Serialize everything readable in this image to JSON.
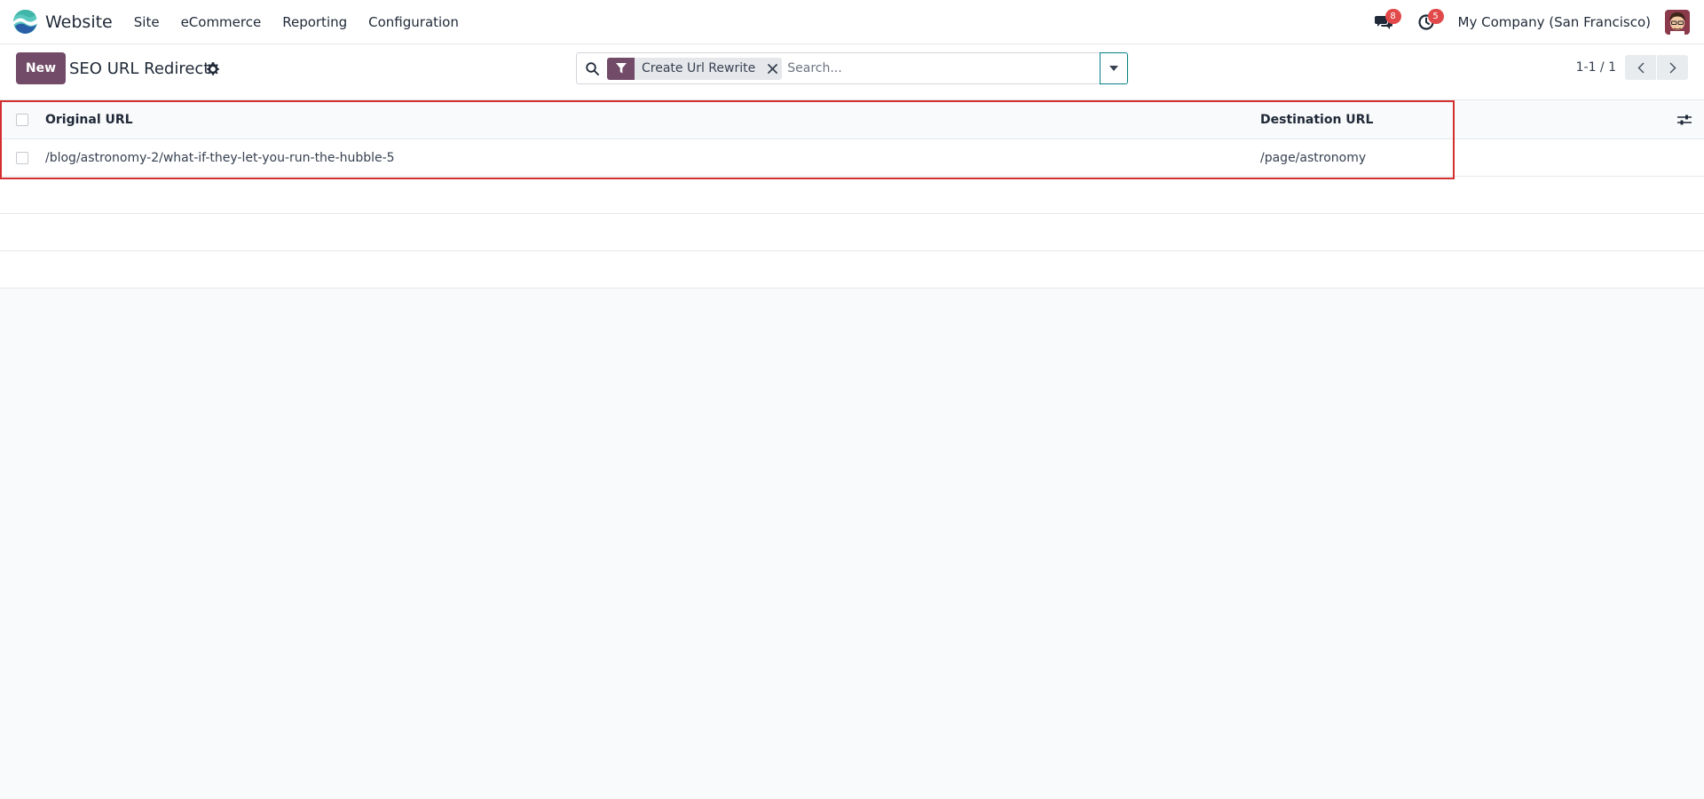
{
  "navbar": {
    "app_name": "Website",
    "menu": [
      "Site",
      "eCommerce",
      "Reporting",
      "Configuration"
    ],
    "messages_badge": "8",
    "activities_badge": "5",
    "company": "My Company (San Francisco)"
  },
  "control_panel": {
    "new_label": "New",
    "title": "SEO URL Redirect",
    "search": {
      "facet": "Create Url Rewrite",
      "placeholder": "Search..."
    },
    "pager": "1-1 / 1"
  },
  "list": {
    "columns": [
      "Original URL",
      "Destination URL"
    ],
    "rows": [
      {
        "original_url": "/blog/astronomy-2/what-if-they-let-you-run-the-hubble-5",
        "destination_url": "/page/astronomy"
      }
    ]
  },
  "colors": {
    "primary": "#714b67",
    "badge": "#e2494a",
    "accent": "#017e84",
    "highlight": "#d32f2f"
  },
  "icons": [
    "app-logo-icon",
    "chat-icon",
    "clock-icon",
    "gear-icon",
    "search-icon",
    "filter-icon",
    "close-icon",
    "caret-down-icon",
    "chevron-left-icon",
    "chevron-right-icon",
    "sliders-icon"
  ]
}
